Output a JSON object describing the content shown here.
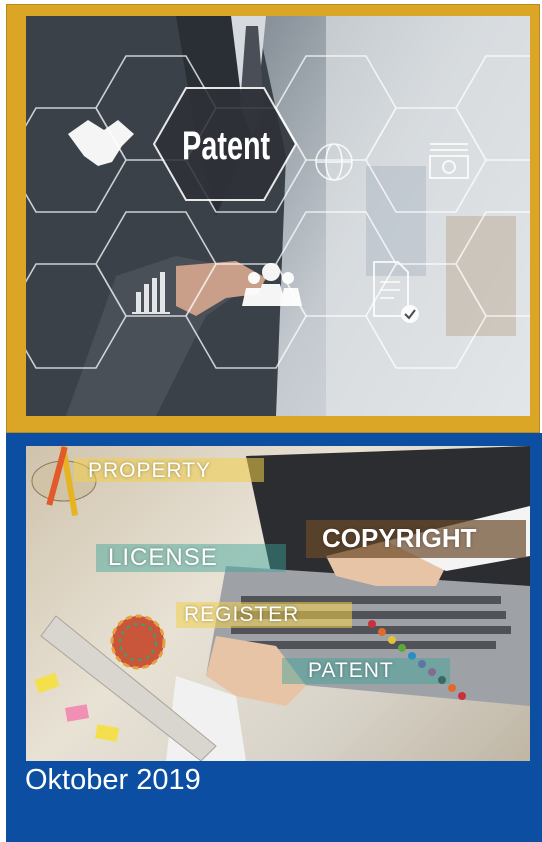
{
  "cover": {
    "hero_image": {
      "label": "Patent",
      "icons": [
        "handshake-icon",
        "globe-icon",
        "money-icon",
        "bar-chart-icon",
        "people-icon",
        "document-check-icon"
      ]
    },
    "secondary_image": {
      "words": [
        "PROPERTY",
        "LICENSE",
        "COPYRIGHT",
        "REGISTER",
        "PATENT"
      ]
    },
    "date": "Oktober 2019",
    "colors": {
      "frame": "#DBA526",
      "panel": "#0B4EA2",
      "date_text": "#FFFFFF"
    }
  }
}
